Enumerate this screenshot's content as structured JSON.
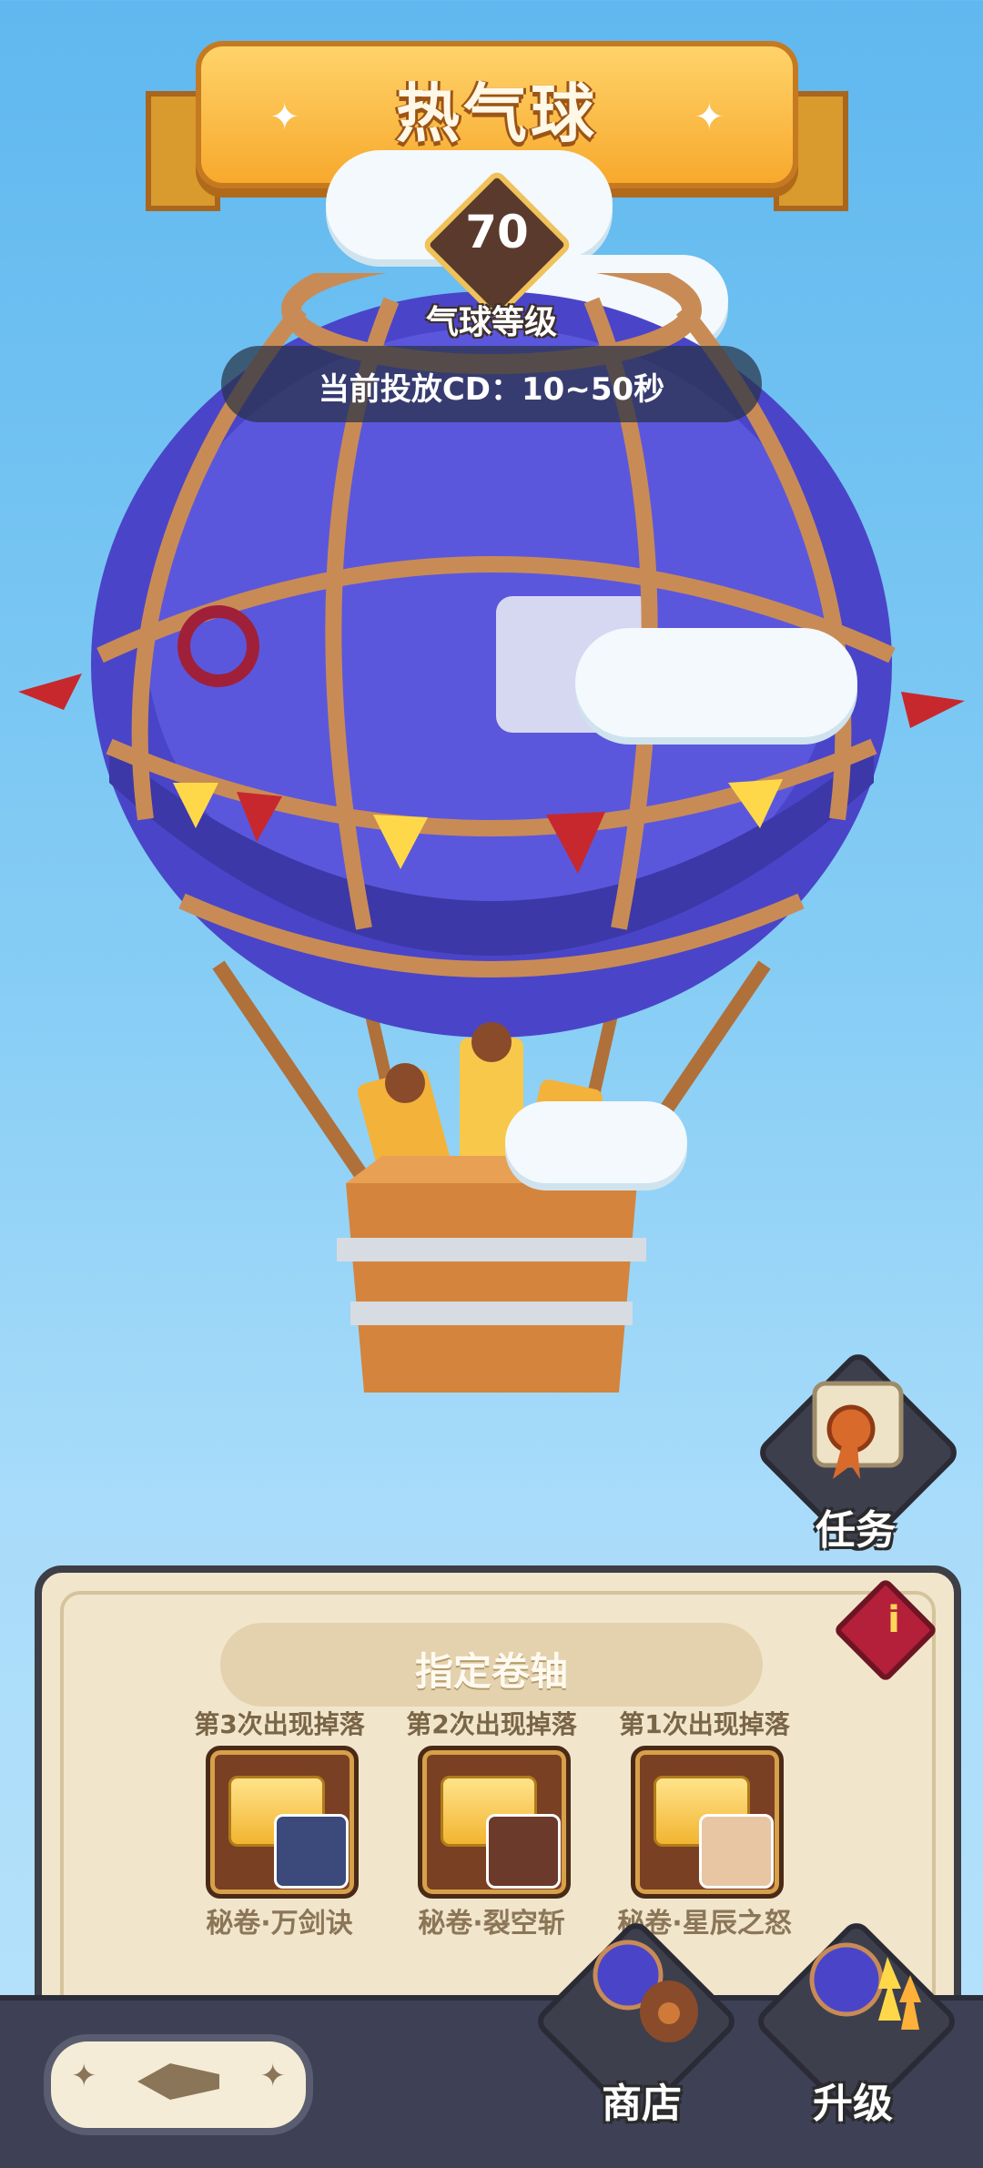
{
  "header": {
    "title": "热气球"
  },
  "balloon": {
    "level": "70",
    "level_label": "气球等级",
    "cd_text": "当前投放CD：10~50秒"
  },
  "task_button": {
    "label": "任务",
    "icon": "scroll-medal-icon"
  },
  "panel": {
    "title": "指定卷轴",
    "info_icon": "info-icon",
    "items": [
      {
        "drop_label": "第3次出现掉落",
        "name": "秘卷·万剑诀",
        "portrait_color": "#3b4a7a"
      },
      {
        "drop_label": "第2次出现掉落",
        "name": "秘卷·裂空斩",
        "portrait_color": "#6b3a2a"
      },
      {
        "drop_label": "第1次出现掉落",
        "name": "秘卷·星辰之怒",
        "portrait_color": "#e8c6a4"
      }
    ]
  },
  "bottom": {
    "shop_label": "商店",
    "upgrade_label": "升级",
    "back_icon": "back-arrow-icon"
  },
  "colors": {
    "sky": "#5fb8ef",
    "balloon": "#4a45c8",
    "banner": "#f7a92c",
    "panel": "#f1e6cc"
  }
}
